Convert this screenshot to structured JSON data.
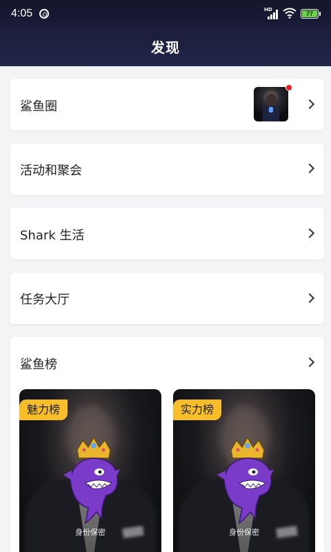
{
  "status_bar": {
    "time": "4:05",
    "signal_label": "HD",
    "battery": "77",
    "battery_color": "#6bd347"
  },
  "header": {
    "title": "发现"
  },
  "menu": {
    "items": [
      {
        "label": "鲨鱼圈",
        "has_new": true
      },
      {
        "label": "活动和聚会"
      },
      {
        "label": "Shark 生活"
      },
      {
        "label": "任务大厅"
      }
    ]
  },
  "leaderboard": {
    "title": "鲨鱼榜",
    "cards": [
      {
        "tag": "魅力榜",
        "caption": "身份保密"
      },
      {
        "tag": "实力榜",
        "caption": "身份保密"
      }
    ]
  },
  "colors": {
    "header_top": "#14162c",
    "header_bottom": "#23264a",
    "tag": "#f7be2a",
    "badge": "#f21b1b"
  },
  "icons": [
    "chevron-right-icon",
    "wifi-icon",
    "signal-icon",
    "battery-icon",
    "notification-dot"
  ]
}
